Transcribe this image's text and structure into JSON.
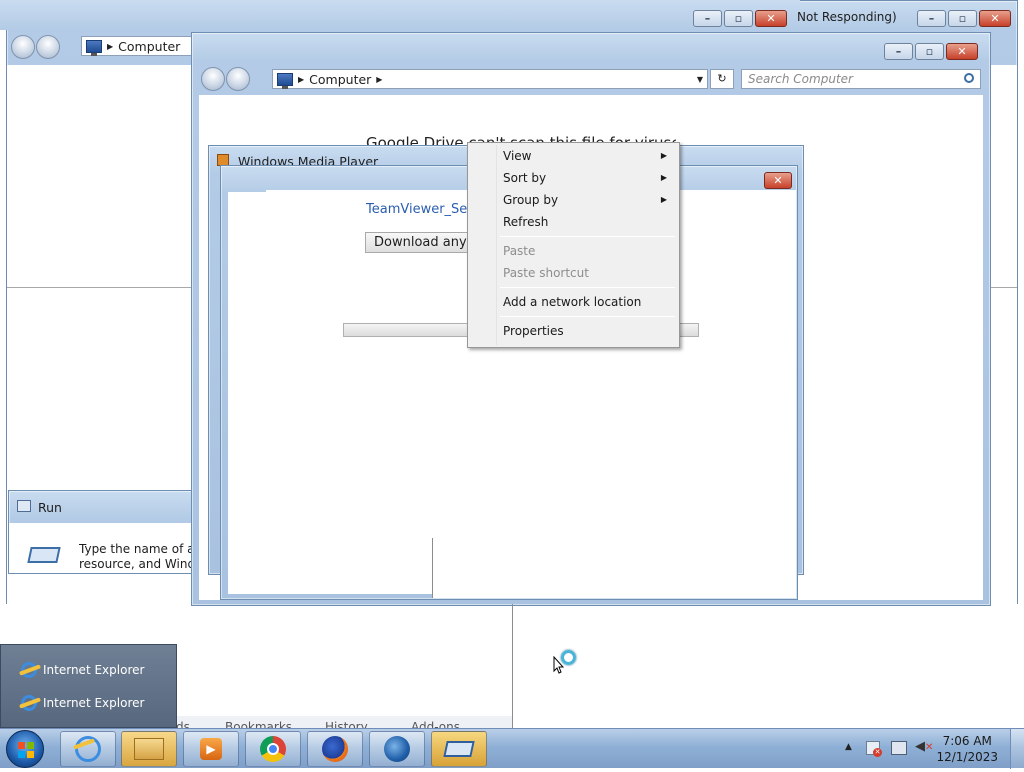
{
  "back_window": {
    "title_fragment": "Not Responding)",
    "address_label": "Computer"
  },
  "explorer": {
    "address_label": "Computer",
    "search_placeholder": "Search Computer"
  },
  "drive_page": {
    "warning_text": "Google Drive can't scan this file for viruses.",
    "file_link": "TeamViewer_Setu",
    "download_button": "Download anyw"
  },
  "media_player": {
    "title": "Windows Media Player"
  },
  "run_dialog": {
    "title": "Run",
    "line1": "Type the name of a prog",
    "line2": "resource, and Windows w"
  },
  "firefox_menubar": {
    "items": [
      "ds",
      "Bookmarks",
      "History",
      "Add-ons"
    ]
  },
  "context_menu": {
    "view": "View",
    "sort_by": "Sort by",
    "group_by": "Group by",
    "refresh": "Refresh",
    "paste": "Paste",
    "paste_shortcut": "Paste shortcut",
    "add_network_location": "Add a network location",
    "properties": "Properties"
  },
  "jump_list": {
    "items": [
      "Internet Explorer",
      "Internet Explorer"
    ]
  },
  "taskbar": {
    "icons": [
      "start-orb",
      "internet-explorer-icon",
      "windows-explorer-icon",
      "media-player-icon",
      "chrome-icon",
      "firefox-icon",
      "thunderbird-icon",
      "run-dialog-icon"
    ]
  },
  "tray": {
    "time": "7:06 AM",
    "date": "12/1/2023"
  },
  "colors": {
    "aero_blue": "#b3cbe6",
    "close_red": "#c7402a",
    "link_blue": "#2a5db0",
    "taskbar": "#8fb0d6"
  }
}
